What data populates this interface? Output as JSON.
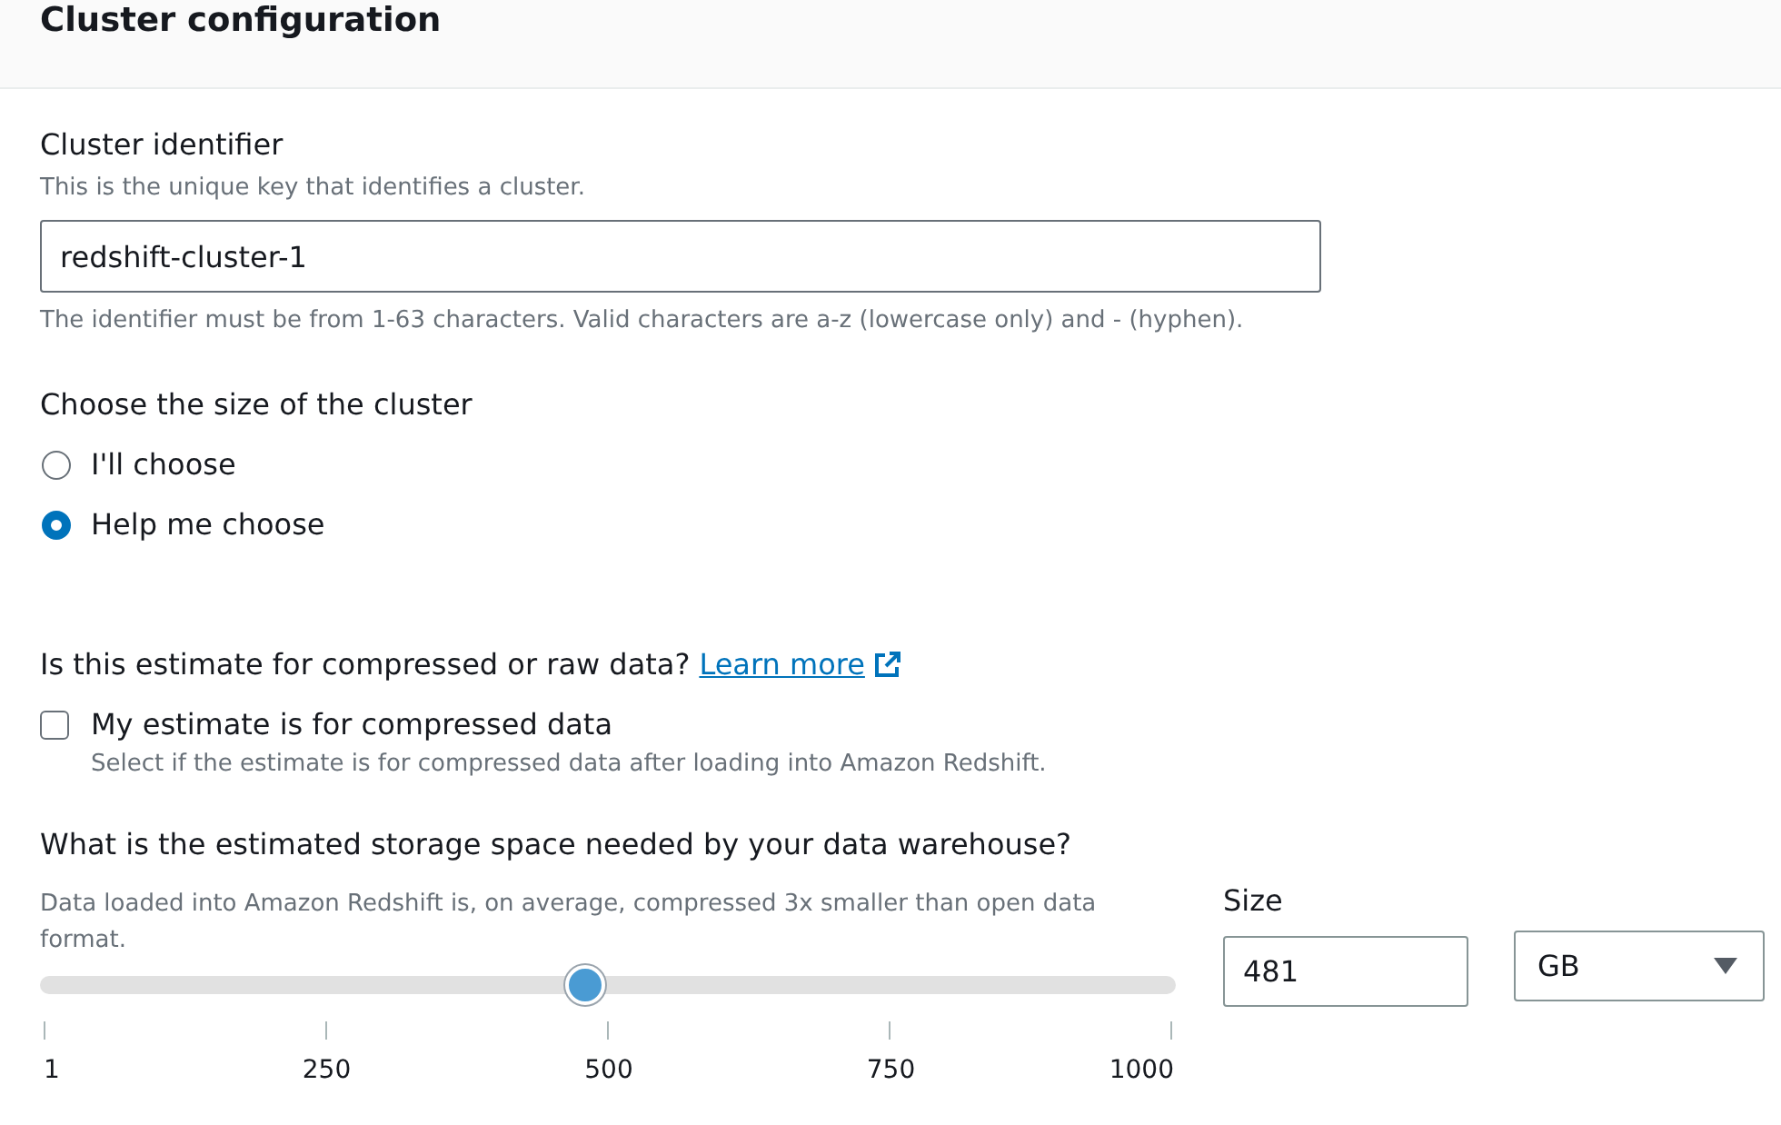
{
  "header": {
    "title": "Cluster configuration"
  },
  "identifier": {
    "label": "Cluster identifier",
    "description": "This is the unique key that identifies a cluster.",
    "value": "redshift-cluster-1",
    "constraint": "The identifier must be from 1-63 characters. Valid characters are a-z (lowercase only) and - (hyphen)."
  },
  "cluster_size": {
    "label": "Choose the size of the cluster",
    "options": [
      {
        "label": "I'll choose",
        "selected": false
      },
      {
        "label": "Help me choose",
        "selected": true
      }
    ]
  },
  "data_type": {
    "question": "Is this estimate for compressed or raw data?",
    "link": "Learn more",
    "checkbox": {
      "label": "My estimate is for compressed data",
      "description": "Select if the estimate is for compressed data after loading into Amazon Redshift.",
      "checked": false
    }
  },
  "storage": {
    "question": "What is the estimated storage space needed by your data warehouse?",
    "description": "Data loaded into Amazon Redshift is, on average, compressed 3x smaller than open data format.",
    "slider": {
      "level": 0.48,
      "ticks": [
        "1",
        "250",
        "500",
        "750",
        "1000"
      ]
    },
    "size": {
      "label": "Size",
      "value": "481"
    },
    "unit": {
      "value": "GB"
    }
  }
}
